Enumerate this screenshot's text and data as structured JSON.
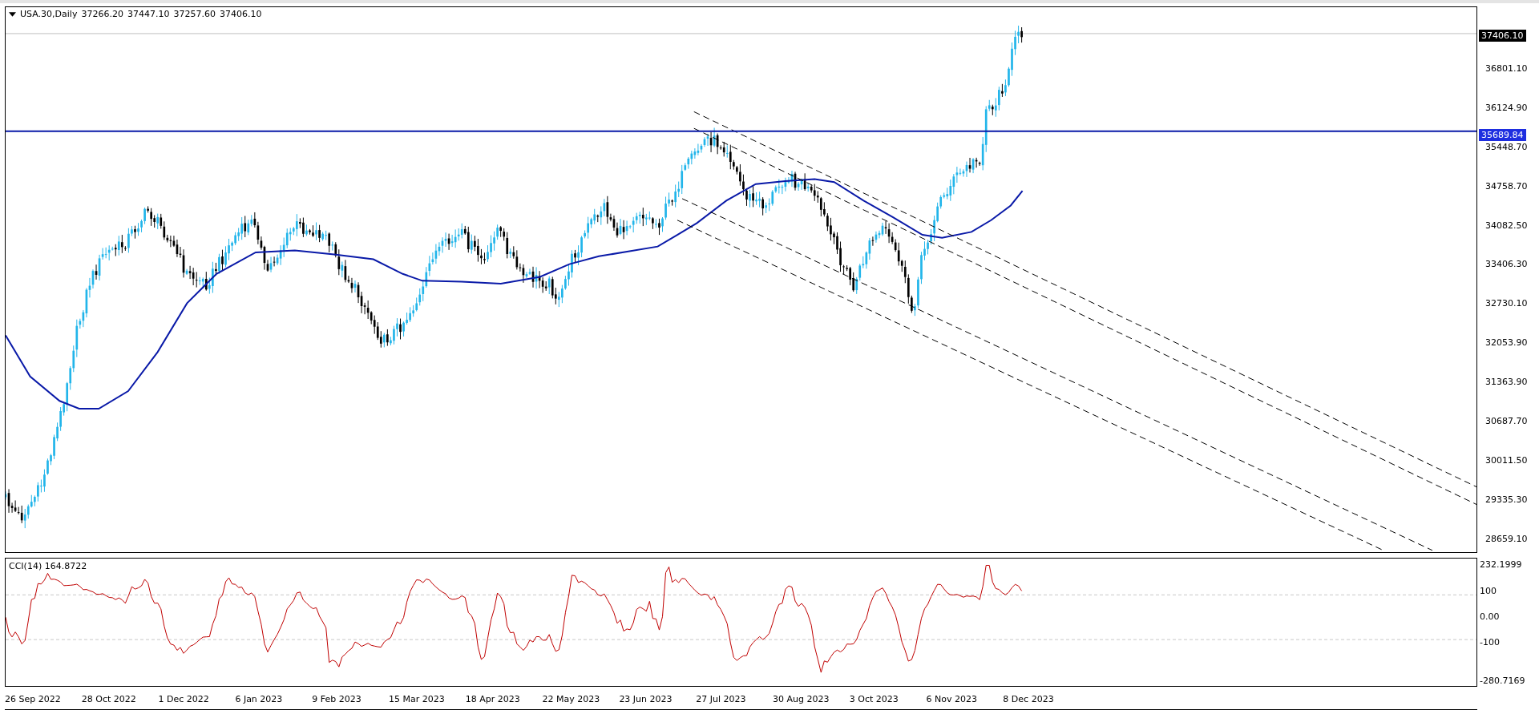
{
  "chart_header": {
    "symbol": "USA.30,Daily",
    "ohlc": [
      "37266.20",
      "37447.10",
      "37257.60",
      "37406.10"
    ]
  },
  "price_axis": {
    "current_price": "37406.10",
    "labels": [
      "36801.10",
      "36124.90",
      "35448.70",
      "34758.70",
      "34082.50",
      "33406.30",
      "32730.10",
      "32053.90",
      "31363.90",
      "30687.70",
      "30011.50",
      "29335.30",
      "28659.10"
    ]
  },
  "level_line": {
    "price_label": "35689.84"
  },
  "indicator": {
    "label": "CCI(14) 164.8722",
    "axis_labels": [
      "232.1999",
      "100",
      "0.00",
      "-100",
      "-280.7169"
    ]
  },
  "time_axis": {
    "labels": [
      "26 Sep 2022",
      "28 Oct 2022",
      "1 Dec 2022",
      "6 Jan 2023",
      "9 Feb 2023",
      "15 Mar 2023",
      "18 Apr 2023",
      "22 May 2023",
      "23 Jun 2023",
      "27 Jul 2023",
      "30 Aug 2023",
      "3 Oct 2023",
      "6 Nov 2023",
      "8 Dec 2023"
    ]
  }
}
